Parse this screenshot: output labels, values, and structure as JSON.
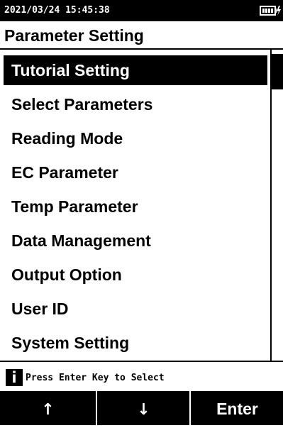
{
  "status": {
    "datetime": "2021/03/24 15:45:38",
    "battery_icon": "battery-charging-icon"
  },
  "header": {
    "title": "Parameter Setting"
  },
  "menu": {
    "items": [
      {
        "label": "Tutorial Setting",
        "selected": true
      },
      {
        "label": "Select Parameters",
        "selected": false
      },
      {
        "label": "Reading Mode",
        "selected": false
      },
      {
        "label": "EC Parameter",
        "selected": false
      },
      {
        "label": "Temp Parameter",
        "selected": false
      },
      {
        "label": "Data Management",
        "selected": false
      },
      {
        "label": "Output Option",
        "selected": false
      },
      {
        "label": "User ID",
        "selected": false
      },
      {
        "label": "System Setting",
        "selected": false
      }
    ]
  },
  "hint": {
    "icon": "info-icon",
    "icon_glyph": "i",
    "text": "Press Enter Key to Select"
  },
  "softkeys": {
    "up": "↑",
    "down": "↓",
    "enter": "Enter"
  },
  "colors": {
    "foreground": "#000000",
    "background": "#ffffff"
  }
}
